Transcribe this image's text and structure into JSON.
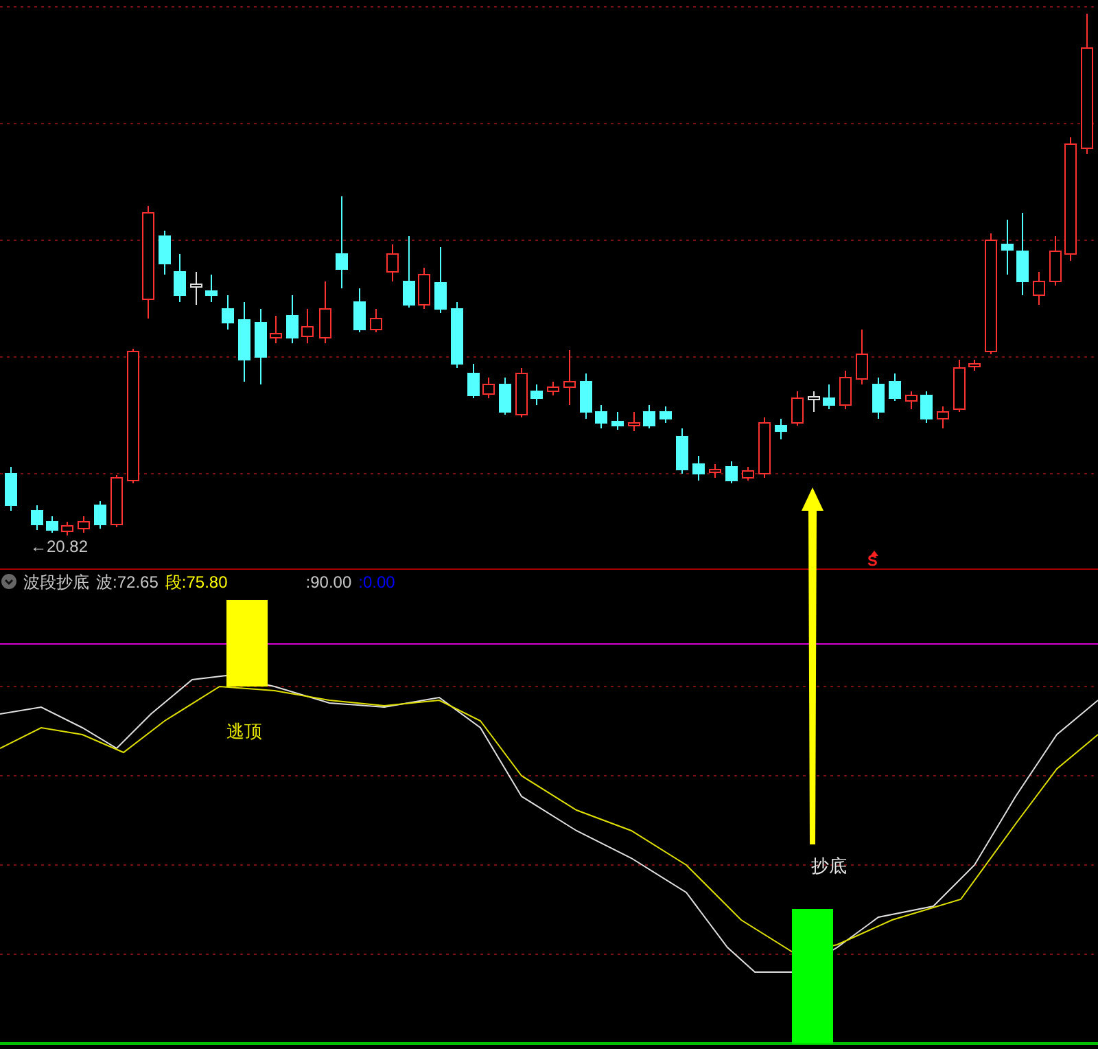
{
  "price_panel": {
    "price_marker": "←20.82",
    "signal_mark": "S"
  },
  "indicator": {
    "name": "波段抄底",
    "values": [
      {
        "label": "波:",
        "value": "72.65",
        "color": "#c8c8c8"
      },
      {
        "label": "段:",
        "value": "75.80",
        "color": "#ffff00"
      },
      {
        "label": ":",
        "value": "90.00",
        "color": "#c8c8c8"
      },
      {
        "label": ":",
        "value": "0.00",
        "color": "#0000ff"
      }
    ],
    "signals": [
      {
        "kind": "top",
        "label": "逃顶"
      },
      {
        "kind": "bottom",
        "label": "抄底"
      }
    ]
  }
}
